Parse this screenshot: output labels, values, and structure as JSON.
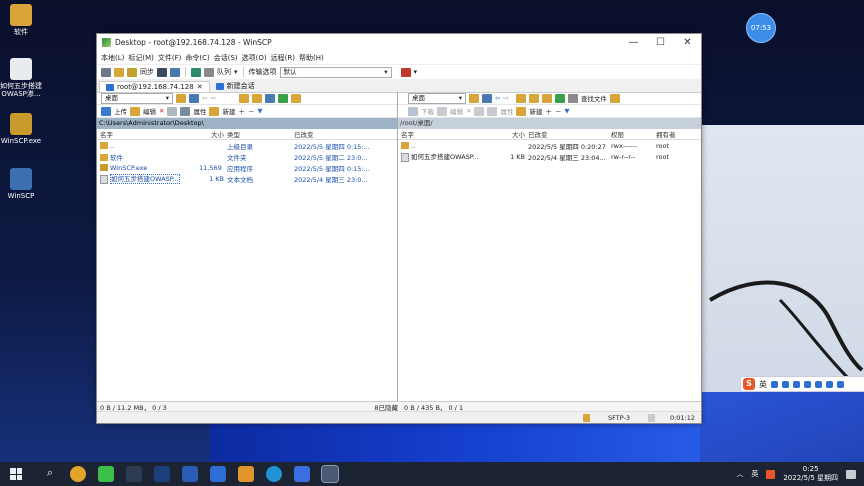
{
  "desktop": {
    "icons": [
      {
        "label": "软件",
        "color": "#d9a43a"
      },
      {
        "label": "如何五步搭建OWASP渗...",
        "color": "#e9ecef"
      },
      {
        "label": "WinSCP.exe",
        "color": "#c99a2e"
      },
      {
        "label": "WinSCP",
        "color": "#3a6fb0"
      }
    ],
    "bubble_time": "07:53"
  },
  "window": {
    "title": "Desktop - root@192.168.74.128 - WinSCP",
    "controls": {
      "minimize": "—",
      "maximize": "☐",
      "close": "✕"
    },
    "menu": [
      "本地(L)",
      "标记(M)",
      "文件(F)",
      "命令(C)",
      "会话(S)",
      "选项(O)",
      "远程(R)",
      "帮助(H)"
    ],
    "toolbar": {
      "sync": "同步",
      "queue": "队列",
      "transfer_label": "传输选项",
      "transfer_value": "默认"
    },
    "tabs": [
      {
        "label": "root@192.168.74.128",
        "close": "✕"
      },
      {
        "label": "新建会话"
      }
    ]
  },
  "left": {
    "location": "桌面",
    "actions": {
      "upload": "上传",
      "edit": "编辑",
      "props": "属性",
      "new": "新建"
    },
    "path": "C:\\Users\\Administrator\\Desktop\\",
    "columns": [
      "名字",
      "大小",
      "类型",
      "已改变"
    ],
    "rows": [
      {
        "name": "..",
        "size": "",
        "type": "上级目录",
        "changed": "2022/5/5 星期四 0:15:..."
      },
      {
        "name": "软件",
        "size": "",
        "type": "文件夹",
        "changed": "2022/5/5 星期二 23:0..."
      },
      {
        "name": "WinSCP.exe",
        "size": "11,569 KB",
        "type": "应用程序",
        "changed": "2022/5/5 星期四 0:15:..."
      },
      {
        "name": "如何五步搭建OWASP...",
        "size": "1 KB",
        "type": "文本文档",
        "changed": "2022/5/4 星期三 23:0..."
      }
    ],
    "status_left": "0 B / 11.2 MB，  0 / 3",
    "status_right": "8已隐藏"
  },
  "right": {
    "location": "桌面",
    "actions": {
      "download": "下载",
      "edit": "编辑",
      "props": "属性",
      "new": "新建",
      "find": "查找文件"
    },
    "path": "/root/桌面/",
    "columns": [
      "名字",
      "大小",
      "已改变",
      "权限",
      "拥有者"
    ],
    "rows": [
      {
        "name": "..",
        "size": "",
        "changed": "2022/5/5 星期四 0:20:27",
        "perm": "rwx------",
        "owner": "root"
      },
      {
        "name": "如何五步搭建OWASP...",
        "size": "1 KB",
        "changed": "2022/5/4 星期三 23:04...",
        "perm": "rw-r--r--",
        "owner": "root"
      }
    ],
    "status_left": "0 B / 435 B，  0 / 1"
  },
  "bottom_status": {
    "protocol": "SFTP-3",
    "elapsed": "0:01:12"
  },
  "ime": {
    "logo": "S",
    "mode": "英"
  },
  "taskbar": {
    "apps": [
      {
        "name": "windows-start-icon",
        "color": "#e9eef5"
      },
      {
        "name": "search-icon",
        "color": "#e9eef5"
      },
      {
        "name": "chrome-icon",
        "color": "#e2a52a"
      },
      {
        "name": "wechat-icon",
        "color": "#3bbf4b"
      },
      {
        "name": "files-icon",
        "color": "#2c3b52"
      },
      {
        "name": "photoshop-icon",
        "color": "#1b3f7a"
      },
      {
        "name": "word-icon",
        "color": "#2b5cb4"
      },
      {
        "name": "virtualbox-icon",
        "color": "#2d6fd4"
      },
      {
        "name": "vmware-icon",
        "color": "#e0962a"
      },
      {
        "name": "edge-icon",
        "color": "#1f93d6"
      },
      {
        "name": "app-icon",
        "color": "#3a6fe0"
      },
      {
        "name": "winscp-taskbar-icon",
        "color": "#4a5a74"
      }
    ],
    "tray_lang": "英",
    "time": "0:25",
    "date": "2022/5/5 星期四"
  }
}
